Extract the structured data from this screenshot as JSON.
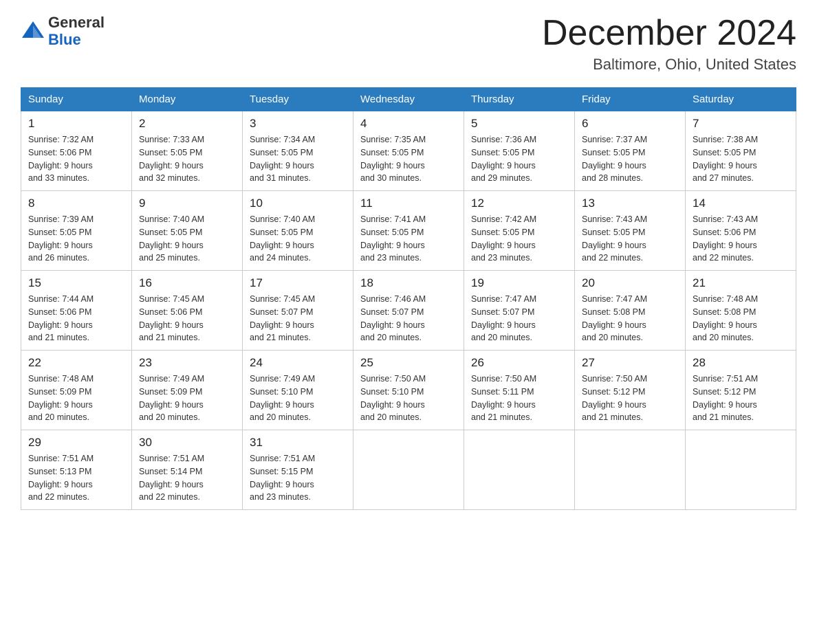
{
  "header": {
    "logo_general": "General",
    "logo_blue": "Blue",
    "month_title": "December 2024",
    "location": "Baltimore, Ohio, United States"
  },
  "days_of_week": [
    "Sunday",
    "Monday",
    "Tuesday",
    "Wednesday",
    "Thursday",
    "Friday",
    "Saturday"
  ],
  "weeks": [
    [
      {
        "day": "1",
        "sunrise": "7:32 AM",
        "sunset": "5:06 PM",
        "daylight": "9 hours and 33 minutes."
      },
      {
        "day": "2",
        "sunrise": "7:33 AM",
        "sunset": "5:05 PM",
        "daylight": "9 hours and 32 minutes."
      },
      {
        "day": "3",
        "sunrise": "7:34 AM",
        "sunset": "5:05 PM",
        "daylight": "9 hours and 31 minutes."
      },
      {
        "day": "4",
        "sunrise": "7:35 AM",
        "sunset": "5:05 PM",
        "daylight": "9 hours and 30 minutes."
      },
      {
        "day": "5",
        "sunrise": "7:36 AM",
        "sunset": "5:05 PM",
        "daylight": "9 hours and 29 minutes."
      },
      {
        "day": "6",
        "sunrise": "7:37 AM",
        "sunset": "5:05 PM",
        "daylight": "9 hours and 28 minutes."
      },
      {
        "day": "7",
        "sunrise": "7:38 AM",
        "sunset": "5:05 PM",
        "daylight": "9 hours and 27 minutes."
      }
    ],
    [
      {
        "day": "8",
        "sunrise": "7:39 AM",
        "sunset": "5:05 PM",
        "daylight": "9 hours and 26 minutes."
      },
      {
        "day": "9",
        "sunrise": "7:40 AM",
        "sunset": "5:05 PM",
        "daylight": "9 hours and 25 minutes."
      },
      {
        "day": "10",
        "sunrise": "7:40 AM",
        "sunset": "5:05 PM",
        "daylight": "9 hours and 24 minutes."
      },
      {
        "day": "11",
        "sunrise": "7:41 AM",
        "sunset": "5:05 PM",
        "daylight": "9 hours and 23 minutes."
      },
      {
        "day": "12",
        "sunrise": "7:42 AM",
        "sunset": "5:05 PM",
        "daylight": "9 hours and 23 minutes."
      },
      {
        "day": "13",
        "sunrise": "7:43 AM",
        "sunset": "5:05 PM",
        "daylight": "9 hours and 22 minutes."
      },
      {
        "day": "14",
        "sunrise": "7:43 AM",
        "sunset": "5:06 PM",
        "daylight": "9 hours and 22 minutes."
      }
    ],
    [
      {
        "day": "15",
        "sunrise": "7:44 AM",
        "sunset": "5:06 PM",
        "daylight": "9 hours and 21 minutes."
      },
      {
        "day": "16",
        "sunrise": "7:45 AM",
        "sunset": "5:06 PM",
        "daylight": "9 hours and 21 minutes."
      },
      {
        "day": "17",
        "sunrise": "7:45 AM",
        "sunset": "5:07 PM",
        "daylight": "9 hours and 21 minutes."
      },
      {
        "day": "18",
        "sunrise": "7:46 AM",
        "sunset": "5:07 PM",
        "daylight": "9 hours and 20 minutes."
      },
      {
        "day": "19",
        "sunrise": "7:47 AM",
        "sunset": "5:07 PM",
        "daylight": "9 hours and 20 minutes."
      },
      {
        "day": "20",
        "sunrise": "7:47 AM",
        "sunset": "5:08 PM",
        "daylight": "9 hours and 20 minutes."
      },
      {
        "day": "21",
        "sunrise": "7:48 AM",
        "sunset": "5:08 PM",
        "daylight": "9 hours and 20 minutes."
      }
    ],
    [
      {
        "day": "22",
        "sunrise": "7:48 AM",
        "sunset": "5:09 PM",
        "daylight": "9 hours and 20 minutes."
      },
      {
        "day": "23",
        "sunrise": "7:49 AM",
        "sunset": "5:09 PM",
        "daylight": "9 hours and 20 minutes."
      },
      {
        "day": "24",
        "sunrise": "7:49 AM",
        "sunset": "5:10 PM",
        "daylight": "9 hours and 20 minutes."
      },
      {
        "day": "25",
        "sunrise": "7:50 AM",
        "sunset": "5:10 PM",
        "daylight": "9 hours and 20 minutes."
      },
      {
        "day": "26",
        "sunrise": "7:50 AM",
        "sunset": "5:11 PM",
        "daylight": "9 hours and 21 minutes."
      },
      {
        "day": "27",
        "sunrise": "7:50 AM",
        "sunset": "5:12 PM",
        "daylight": "9 hours and 21 minutes."
      },
      {
        "day": "28",
        "sunrise": "7:51 AM",
        "sunset": "5:12 PM",
        "daylight": "9 hours and 21 minutes."
      }
    ],
    [
      {
        "day": "29",
        "sunrise": "7:51 AM",
        "sunset": "5:13 PM",
        "daylight": "9 hours and 22 minutes."
      },
      {
        "day": "30",
        "sunrise": "7:51 AM",
        "sunset": "5:14 PM",
        "daylight": "9 hours and 22 minutes."
      },
      {
        "day": "31",
        "sunrise": "7:51 AM",
        "sunset": "5:15 PM",
        "daylight": "9 hours and 23 minutes."
      },
      null,
      null,
      null,
      null
    ]
  ],
  "labels": {
    "sunrise": "Sunrise:",
    "sunset": "Sunset:",
    "daylight": "Daylight:"
  }
}
